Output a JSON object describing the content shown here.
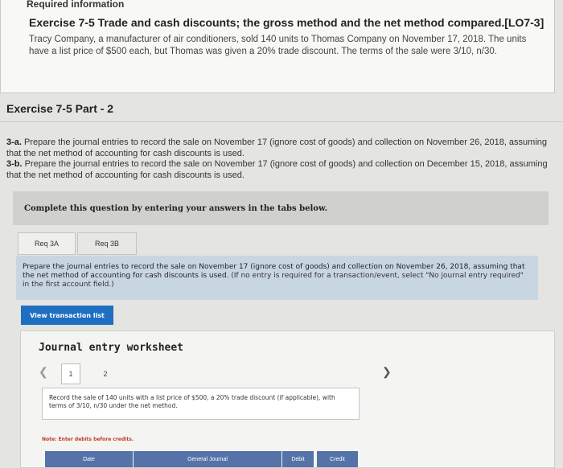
{
  "header": {
    "required_info": "Required information",
    "exercise_title": "Exercise 7-5 Trade and cash discounts; the gross method and the net method compared.[LO7-3]",
    "description": "Tracy Company, a manufacturer of air conditioners, sold 140 units to Thomas Company on November 17, 2018. The units have a list price of $500 each, but Thomas was given a 20% trade discount. The terms of the sale were 3/10, n/30."
  },
  "part_title": "Exercise 7-5 Part - 2",
  "instructions": {
    "a_label": "3-a.",
    "a_text": " Prepare the journal entries to record the sale on November 17 (ignore cost of goods) and collection on November 26, 2018, assuming that the net method of accounting for cash discounts is used.",
    "b_label": "3-b.",
    "b_text": " Prepare the journal entries to record the sale on November 17 (ignore cost of goods) and collection on December 15, 2018, assuming that the net method of accounting for cash discounts is used."
  },
  "complete_text": "Complete this question by entering your answers in the tabs below.",
  "tabs": [
    {
      "label": "Req 3A"
    },
    {
      "label": "Req 3B"
    }
  ],
  "prepare": {
    "text": "Prepare the journal entries to record the sale on November 17 (ignore cost of goods) and collection on November 26, 2018, assuming that the net method of accounting for cash discounts is used.",
    "note": " (If no entry is required for a transaction/event, select \"No journal entry required\" in the first account field.)"
  },
  "view_button": "View transaction list",
  "worksheet": {
    "title": "Journal entry worksheet",
    "pages": [
      "1",
      "2"
    ],
    "record_text": "Record the sale of 140 units with a list price of $500, a 20% trade discount (if applicable), with terms of 3/10, n/30 under the net method.",
    "note": "Note: Enter debits before credits.",
    "columns": {
      "date": "Date",
      "journal": "General Journal",
      "debit": "Debit",
      "credit": "Credit"
    }
  },
  "icons": {
    "prev": "chevron-left-icon",
    "next": "chevron-right-icon"
  },
  "colors": {
    "button_blue": "#1e6fc1",
    "header_blue": "#5573a8",
    "prepare_bg": "#c8d6e2",
    "note_red": "#c0392b"
  }
}
